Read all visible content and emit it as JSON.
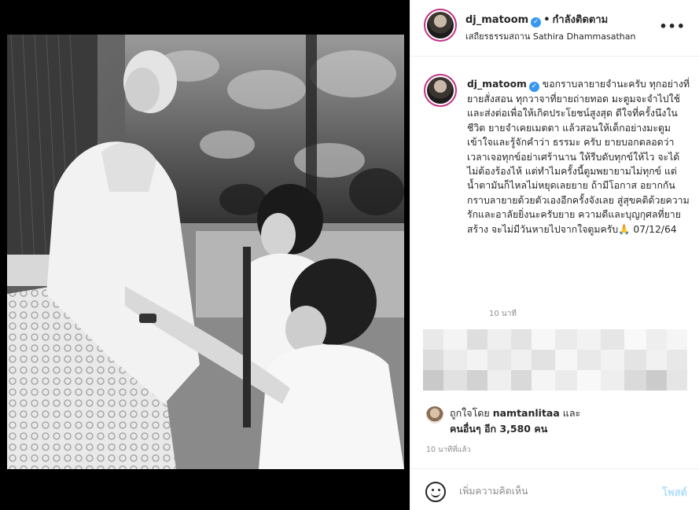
{
  "post": {
    "username": "dj_matoom",
    "verified_glyph": "✓",
    "separator": "•",
    "follow_status": "กำลังติดตาม",
    "location": "เสถียรธรรมสถาน Sathira Dhammasathan",
    "more_icon": "•••"
  },
  "caption": {
    "username": "dj_matoom",
    "text": "ขอกราบลายายจำนะครับ ทุกอย่างที่ยายสั่งสอน ทุกวาจาที่ยายถ่ายทอด มะตูมจะจำไปใช้และส่งต่อเพื่อให้เกิดประโยชน์สูงสุด ดีใจที่ครั้งนึงในชีวิต ยายจำเคยเมตตา แล้วสอนให้เด็กอย่างมะตูม เข้าใจและรู้จักคำว่า ธรรมะ ครับ ยายบอกตลอดว่าเวลาเจอทุกข์อย่าเศร้านาน ให้รีบดับทุกข์ให้ไว จะได้ไม่ต้องร้องไห้ แต่ทำไมครั้งนี้ตูมพยายามไม่ทุกข์ แต่น้ำตามันก็ไหลไม่หยุดเลยยาย ถ้ามีโอกาส อยากกันกราบลายายด้วยตัวเองอีกครั้งจังเลย สู่สุขคติด้วยความรักและอาลัยยิ่งนะครับยาย ความดีและบุญกุศลที่ยายสร้าง จะไม่มีวันหายไปจากใจตูมครับ🙏 07/12/64",
    "time": "10 นาที"
  },
  "likes": {
    "prefix": "ถูกใจโดย",
    "liker": "namtanlitaa",
    "joiner": "และ",
    "others": "คนอื่นๆ อีก 3,580 คน"
  },
  "post_time": "10 นาทีที่แล้ว",
  "comment": {
    "placeholder": "เพิ่มความคิดเห็น",
    "post_label": "โพสต์"
  },
  "colors": {
    "verified": "#3897f0",
    "post_button": "#b2dffc",
    "muted_text": "#8e8e8e"
  },
  "icons": {
    "verified": "verified-badge-icon",
    "emoji": "smiley-icon",
    "more": "more-options-icon"
  }
}
